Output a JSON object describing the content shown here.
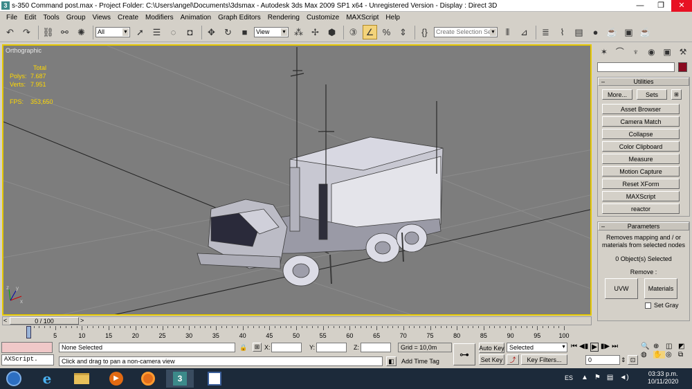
{
  "window": {
    "title": "s-350 Command post.max    - Project Folder: C:\\Users\\angel\\Documents\\3dsmax    - Autodesk 3ds Max  2009 SP1  x64   - Unregistered Version    - Display : Direct 3D",
    "app_icon": "3ds-max-icon",
    "minimize": "—",
    "maximize": "❐",
    "close": "✕"
  },
  "menu": [
    "File",
    "Edit",
    "Tools",
    "Group",
    "Views",
    "Create",
    "Modifiers",
    "Animation",
    "Graph Editors",
    "Rendering",
    "Customize",
    "MAXScript",
    "Help"
  ],
  "toolbar": {
    "selection_filter": "All",
    "ref_coord": "View",
    "named_selection_placeholder": "Create Selection Set"
  },
  "viewport": {
    "label": "Orthographic",
    "stats": {
      "total_label": "Total",
      "polys_label": "Polys:",
      "polys_value": "7.687",
      "verts_label": "Verts:",
      "verts_value": "7.951",
      "fps_label": "FPS:",
      "fps_value": "353,650"
    },
    "axis_x": "x",
    "axis_y": "y",
    "axis_z": "z"
  },
  "command_panel": {
    "utilities": {
      "title": "Utilities",
      "more": "More...",
      "sets": "Sets",
      "items": [
        "Asset Browser",
        "Camera Match",
        "Collapse",
        "Color Clipboard",
        "Measure",
        "Motion Capture",
        "Reset XForm",
        "MAXScript",
        "reactor"
      ]
    },
    "parameters": {
      "title": "Parameters",
      "description": "Removes mapping and / or materials from selected nodes",
      "selected": "0 Object(s) Selected",
      "remove_label": "Remove :",
      "uvw": "UVW",
      "materials": "Materials",
      "set_gray": "Set Gray"
    },
    "color_swatch": "#8a0a20"
  },
  "timeline": {
    "frame": "0 / 100",
    "ticks": [
      "0",
      "5",
      "10",
      "15",
      "20",
      "25",
      "30",
      "35",
      "40",
      "45",
      "50",
      "55",
      "60",
      "65",
      "70",
      "75",
      "80",
      "85",
      "90",
      "95",
      "100"
    ]
  },
  "status": {
    "maxscript": "AXScript.",
    "selection": "None Selected",
    "prompt": "Click and drag to pan a non-camera view",
    "x_label": "X:",
    "y_label": "Y:",
    "z_label": "Z:",
    "grid": "Grid = 10,0m",
    "add_time_tag": "Add Time Tag",
    "auto_key": "Auto Key",
    "set_key": "Set Key",
    "key_mode": "Selected",
    "key_filters": "Key Filters...",
    "current_frame": "0"
  },
  "taskbar": {
    "language": "ES",
    "time": "03:33 p.m.",
    "date": "10/11/2020"
  }
}
